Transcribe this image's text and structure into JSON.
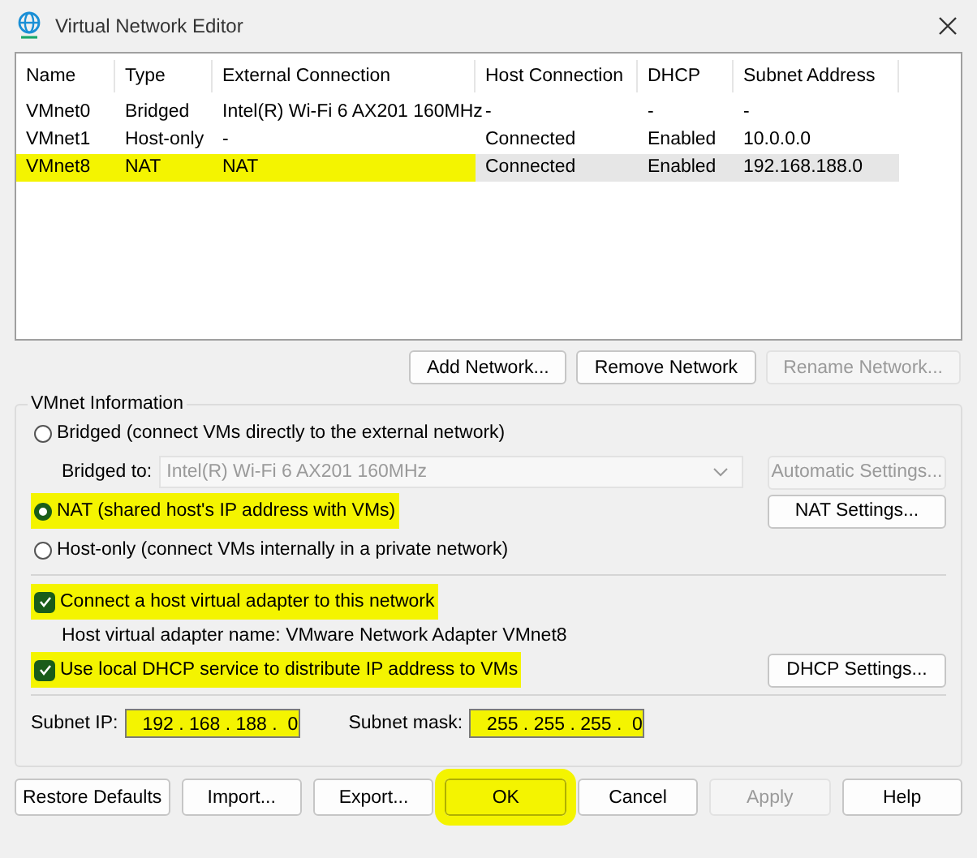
{
  "window": {
    "title": "Virtual Network Editor"
  },
  "table": {
    "columns": [
      "Name",
      "Type",
      "External Connection",
      "Host Connection",
      "DHCP",
      "Subnet Address"
    ],
    "rows": [
      {
        "selected": false,
        "cells": [
          {
            "text": "VMnet0",
            "highlighted": false
          },
          {
            "text": "Bridged",
            "highlighted": false
          },
          {
            "text": "Intel(R) Wi-Fi 6 AX201 160MHz",
            "highlighted": false
          },
          {
            "text": "-",
            "highlighted": false
          },
          {
            "text": "-",
            "highlighted": false
          },
          {
            "text": "-",
            "highlighted": false
          }
        ]
      },
      {
        "selected": false,
        "cells": [
          {
            "text": "VMnet1",
            "highlighted": false
          },
          {
            "text": "Host-only",
            "highlighted": false
          },
          {
            "text": "-",
            "highlighted": false
          },
          {
            "text": "Connected",
            "highlighted": false
          },
          {
            "text": "Enabled",
            "highlighted": false
          },
          {
            "text": "10.0.0.0",
            "highlighted": false
          }
        ]
      },
      {
        "selected": true,
        "cells": [
          {
            "text": "VMnet8",
            "highlighted": true
          },
          {
            "text": "NAT",
            "highlighted": true
          },
          {
            "text": "NAT",
            "highlighted": true
          },
          {
            "text": "Connected",
            "highlighted": false
          },
          {
            "text": "Enabled",
            "highlighted": false
          },
          {
            "text": "192.168.188.0",
            "highlighted": false
          }
        ]
      }
    ]
  },
  "network_buttons": [
    {
      "label": "Add Network...",
      "disabled": false
    },
    {
      "label": "Remove Network",
      "disabled": false
    },
    {
      "label": "Rename Network...",
      "disabled": true
    }
  ],
  "vmnet_info": {
    "title": "VMnet Information",
    "bridged": {
      "label": "Bridged (connect VMs directly to the external network)",
      "selected": false,
      "highlighted": false
    },
    "bridged_to": {
      "label": "Bridged to:",
      "value": "Intel(R) Wi-Fi 6 AX201 160MHz",
      "disabled": true
    },
    "automatic_settings": {
      "label": "Automatic Settings...",
      "disabled": true
    },
    "nat": {
      "label": "NAT (shared host's IP address with VMs)",
      "selected": true,
      "highlighted": true
    },
    "nat_settings": {
      "label": "NAT Settings...",
      "disabled": false
    },
    "host_only": {
      "label": "Host-only (connect VMs internally in a private network)",
      "selected": false,
      "highlighted": false
    },
    "connect_adapter": {
      "label": "Connect a host virtual adapter to this network",
      "checked": true,
      "highlighted": true
    },
    "adapter_name": "Host virtual adapter name: VMware Network Adapter VMnet8",
    "use_dhcp": {
      "label": "Use local DHCP service to distribute IP address to VMs",
      "checked": true,
      "highlighted": true
    },
    "dhcp_settings": {
      "label": "DHCP Settings...",
      "disabled": false
    },
    "subnet_ip": {
      "label": "Subnet IP:",
      "value": "192 . 168 . 188 .  0",
      "highlighted": true
    },
    "subnet_mask": {
      "label": "Subnet mask:",
      "value": "255 . 255 . 255 .  0",
      "highlighted": true
    }
  },
  "footer_buttons": [
    {
      "label": "Restore Defaults",
      "disabled": false,
      "highlighted": false
    },
    {
      "label": "Import...",
      "disabled": false,
      "highlighted": false
    },
    {
      "label": "Export...",
      "disabled": false,
      "highlighted": false
    },
    {
      "label": "OK",
      "disabled": false,
      "highlighted": true
    },
    {
      "label": "Cancel",
      "disabled": false,
      "highlighted": false
    },
    {
      "label": "Apply",
      "disabled": true,
      "highlighted": false
    },
    {
      "label": "Help",
      "disabled": false,
      "highlighted": false
    }
  ]
}
